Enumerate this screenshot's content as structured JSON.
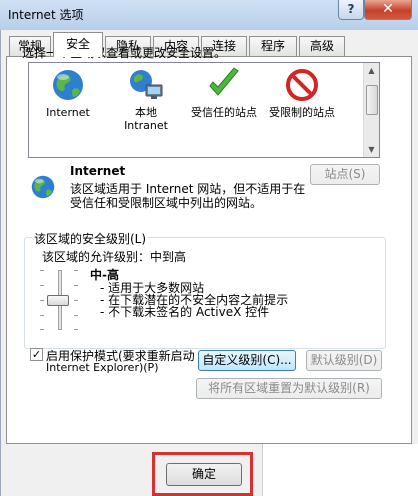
{
  "window": {
    "title": "Internet 选项",
    "help_label": "?",
    "close_label": "✕"
  },
  "tabs": [
    {
      "label": "常规",
      "active": false
    },
    {
      "label": "安全",
      "active": true
    },
    {
      "label": "隐私",
      "active": false
    },
    {
      "label": "内容",
      "active": false
    },
    {
      "label": "连接",
      "active": false
    },
    {
      "label": "程序",
      "active": false
    },
    {
      "label": "高级",
      "active": false
    }
  ],
  "security": {
    "instruction": "选择一个区域以查看或更改安全设置。",
    "zones": [
      {
        "name": "Internet",
        "icon": "globe-icon"
      },
      {
        "name": "本地\nIntranet",
        "icon": "network-icon"
      },
      {
        "name": "受信任的站点",
        "icon": "checkmark-icon"
      },
      {
        "name": "受限制的站点",
        "icon": "no-entry-icon"
      }
    ],
    "selected_zone": {
      "name": "Internet",
      "icon": "globe-icon",
      "description": "该区域适用于 Internet 网站，但不适用于在受信任和受限制区域中列出的网站。",
      "sites_button": "站点(S)"
    },
    "level_group": {
      "legend": "该区域的安全级别(L)",
      "allowed": "该区域的允许级别：中到高",
      "level_name": "中-高",
      "level_bullets": [
        "- 适用于大多数网站",
        "- 在下载潜在的不安全内容之前提示",
        "- 不下载未签名的 ActiveX 控件"
      ],
      "slider_level": 0.5
    },
    "protected_mode": {
      "checked": true,
      "label_line1": "启用保护模式(要求重新启动",
      "label_line2": "Internet Explorer)(P)"
    },
    "custom_level_button": "自定义级别(C)...",
    "default_level_button": "默认级别(D)",
    "reset_all_button": "将所有区域重置为默认级别(R)"
  },
  "footer": {
    "ok_button": "确定"
  },
  "colors": {
    "highlight_border": "#d63030",
    "title_bar": "#c3d6ee",
    "close_button": "#c4412a"
  }
}
